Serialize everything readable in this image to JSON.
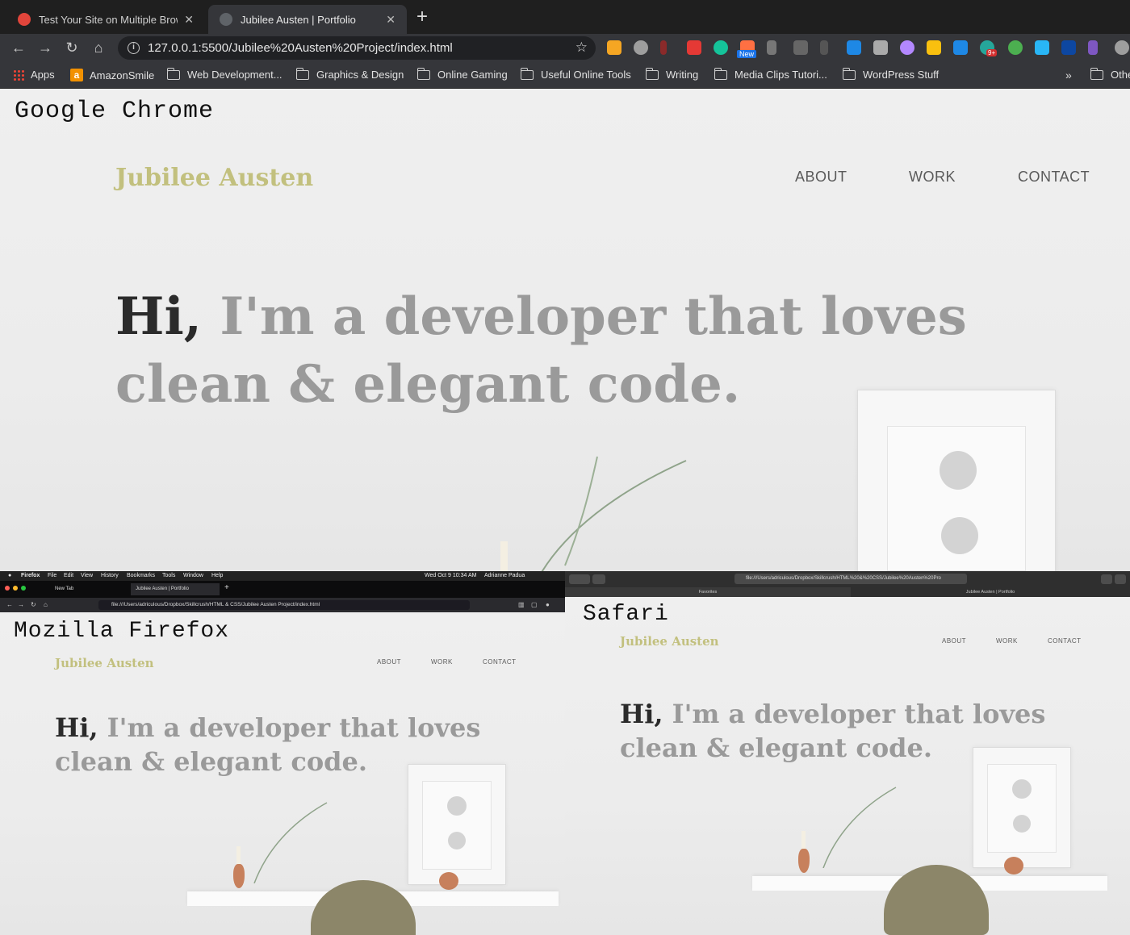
{
  "chrome": {
    "label": "Google Chrome",
    "tabs": [
      {
        "title": "Test Your Site on Multiple Brow",
        "active": false
      },
      {
        "title": "Jubilee Austen | Portfolio",
        "active": true
      }
    ],
    "new_tab": "+",
    "url": "127.0.0.1:5500/Jubilee%20Austen%20Project/index.html",
    "bookmarks": [
      "Apps",
      "AmazonSmile",
      "Web Development...",
      "Graphics & Design",
      "Online Gaming",
      "Useful Online Tools",
      "Writing",
      "Media Clips Tutori...",
      "WordPress Stuff",
      "Othe"
    ],
    "bookmarks_overflow": "»",
    "extension_badges": {
      "new": "New",
      "count": "9+"
    }
  },
  "site": {
    "logo": "Jubilee Austen",
    "nav": [
      "ABOUT",
      "WORK",
      "CONTACT"
    ],
    "hero_hi": "Hi,",
    "hero_line1_rest": " I'm a developer that loves",
    "hero_line2": "clean & elegant code.",
    "colors": {
      "logo": "#c2c07e",
      "hi": "#2b2b2b",
      "hero": "#9a9a9a"
    }
  },
  "firefox": {
    "label": "Mozilla Firefox",
    "menu": [
      "Firefox",
      "File",
      "Edit",
      "View",
      "History",
      "Bookmarks",
      "Tools",
      "Window",
      "Help"
    ],
    "clock": "Wed Oct 9 10:34 AM",
    "user": "Adrianne Padua",
    "tabs": [
      "New Tab",
      "Jubilee Austen | Portfolio"
    ],
    "url": "file:///Users/adriculous/Dropbox/Skillcrush/HTML & CSS/Jubilee Austen Project/index.html"
  },
  "safari": {
    "label": "Safari",
    "url": "file:///Users/adriculous/Dropbox/Skillcrush/HTML%20&%20CSS/Jubilee%20Austen%20Pro",
    "tabs": [
      "Favorites",
      "Jubilee Austen | Portfolio"
    ]
  }
}
